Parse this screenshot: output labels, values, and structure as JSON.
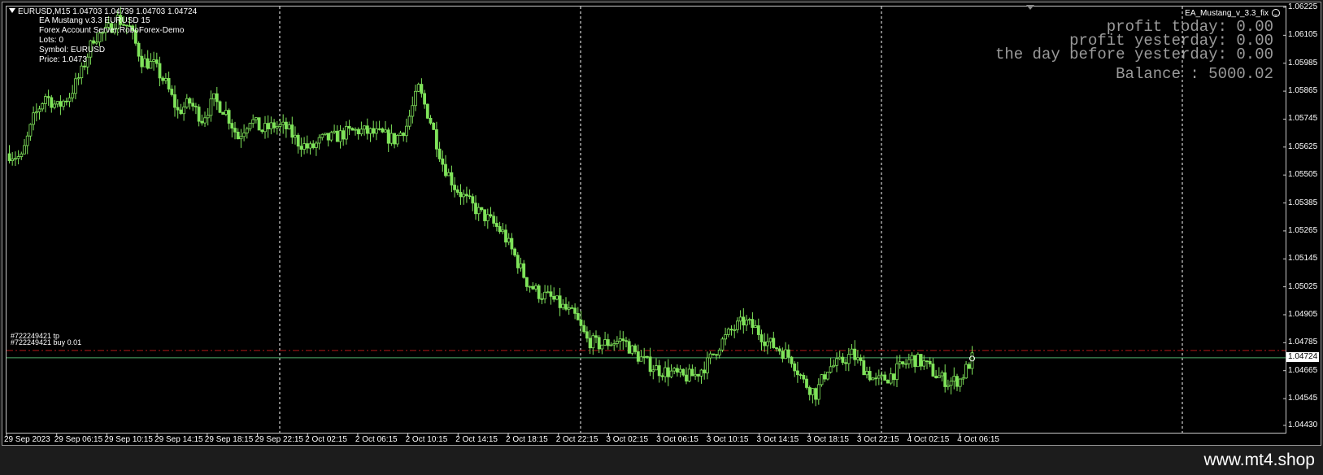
{
  "header": {
    "symbol_info": "EURUSD,M15  1.04703 1.04739 1.04703 1.04724"
  },
  "ea_info": [
    "EA Mustang v.3.3 EURUSD  15",
    "Forex Account Server:RoboForex-Demo",
    "Lots:  0",
    "Symbol: EURUSD",
    "Price:  1.0473"
  ],
  "ea_name": "EA_Mustang_v_3.3_fix",
  "stats": {
    "profit_today": "profit today: 0.00",
    "profit_yesterday": "profit yesterday: 0.00",
    "day_before": "the day before yesterday: 0.00",
    "balance": "Balance : 5000.02"
  },
  "orders": {
    "tp_label": "#722249421 tp",
    "buy_label": "#722249421 buy 0.01"
  },
  "current_price": "1.04724",
  "watermark": "www.mt4.shop",
  "colors": {
    "candle": "#7fe35a",
    "tp_line": "#b01818",
    "buy_line": "#4fae6b",
    "grid": "#ffffff"
  },
  "chart_data": {
    "type": "candlestick",
    "symbol": "EURUSD",
    "timeframe": "M15",
    "ylim": [
      1.0443,
      1.06225
    ],
    "price_ticks": [
      "1.06225",
      "1.06105",
      "1.05985",
      "1.05865",
      "1.05745",
      "1.05625",
      "1.05505",
      "1.05385",
      "1.05265",
      "1.05145",
      "1.05025",
      "1.04905",
      "1.04785",
      "1.04665",
      "1.04545",
      "1.04430"
    ],
    "time_ticks": [
      "29 Sep 2023",
      "29 Sep 06:15",
      "29 Sep 10:15",
      "29 Sep 14:15",
      "29 Sep 18:15",
      "29 Sep 22:15",
      "2 Oct 02:15",
      "2 Oct 06:15",
      "2 Oct 10:15",
      "2 Oct 14:15",
      "2 Oct 18:15",
      "2 Oct 22:15",
      "3 Oct 02:15",
      "3 Oct 06:15",
      "3 Oct 10:15",
      "3 Oct 14:15",
      "3 Oct 18:15",
      "3 Oct 22:15",
      "4 Oct 02:15",
      "4 Oct 06:15"
    ],
    "tp_price": 1.04755,
    "buy_price": 1.04724,
    "price_path": [
      [
        0,
        1.056
      ],
      [
        4,
        1.0558
      ],
      [
        8,
        1.0575
      ],
      [
        12,
        1.0585
      ],
      [
        16,
        1.058
      ],
      [
        20,
        1.0585
      ],
      [
        24,
        1.0595
      ],
      [
        28,
        1.061
      ],
      [
        32,
        1.0612
      ],
      [
        36,
        1.0618
      ],
      [
        40,
        1.0614
      ],
      [
        44,
        1.06
      ],
      [
        48,
        1.0598
      ],
      [
        52,
        1.059
      ],
      [
        56,
        1.0578
      ],
      [
        60,
        1.0582
      ],
      [
        64,
        1.0575
      ],
      [
        68,
        1.0583
      ],
      [
        72,
        1.0578
      ],
      [
        76,
        1.0567
      ],
      [
        80,
        1.0575
      ],
      [
        84,
        1.057
      ],
      [
        88,
        1.0572
      ],
      [
        92,
        1.0571
      ],
      [
        96,
        1.0565
      ],
      [
        100,
        1.0562
      ],
      [
        104,
        1.0566
      ],
      [
        108,
        1.0567
      ],
      [
        112,
        1.0569
      ],
      [
        116,
        1.057
      ],
      [
        120,
        1.0569
      ],
      [
        124,
        1.0568
      ],
      [
        128,
        1.0566
      ],
      [
        132,
        1.0572
      ],
      [
        136,
        1.0588
      ],
      [
        140,
        1.0574
      ],
      [
        144,
        1.0556
      ],
      [
        148,
        1.0546
      ],
      [
        152,
        1.054
      ],
      [
        156,
        1.0535
      ],
      [
        160,
        1.0531
      ],
      [
        164,
        1.0526
      ],
      [
        168,
        1.0516
      ],
      [
        172,
        1.0505
      ],
      [
        176,
        1.05
      ],
      [
        180,
        1.0498
      ],
      [
        184,
        1.0494
      ],
      [
        188,
        1.049
      ],
      [
        192,
        1.048
      ],
      [
        196,
        1.0478
      ],
      [
        200,
        1.0479
      ],
      [
        204,
        1.048
      ],
      [
        208,
        1.0474
      ],
      [
        212,
        1.047
      ],
      [
        216,
        1.0467
      ],
      [
        220,
        1.0466
      ],
      [
        224,
        1.0464
      ],
      [
        228,
        1.0465
      ],
      [
        232,
        1.047
      ],
      [
        236,
        1.0478
      ],
      [
        240,
        1.0484
      ],
      [
        244,
        1.0488
      ],
      [
        248,
        1.0485
      ],
      [
        252,
        1.0479
      ],
      [
        256,
        1.0476
      ],
      [
        260,
        1.0472
      ],
      [
        264,
        1.0462
      ],
      [
        268,
        1.0457
      ],
      [
        272,
        1.0468
      ],
      [
        276,
        1.047
      ],
      [
        280,
        1.0474
      ],
      [
        284,
        1.0468
      ],
      [
        288,
        1.0462
      ],
      [
        292,
        1.0464
      ],
      [
        296,
        1.0468
      ],
      [
        300,
        1.0472
      ],
      [
        304,
        1.047
      ],
      [
        308,
        1.0465
      ],
      [
        312,
        1.0462
      ],
      [
        316,
        1.0463
      ],
      [
        320,
        1.0472
      ]
    ]
  }
}
